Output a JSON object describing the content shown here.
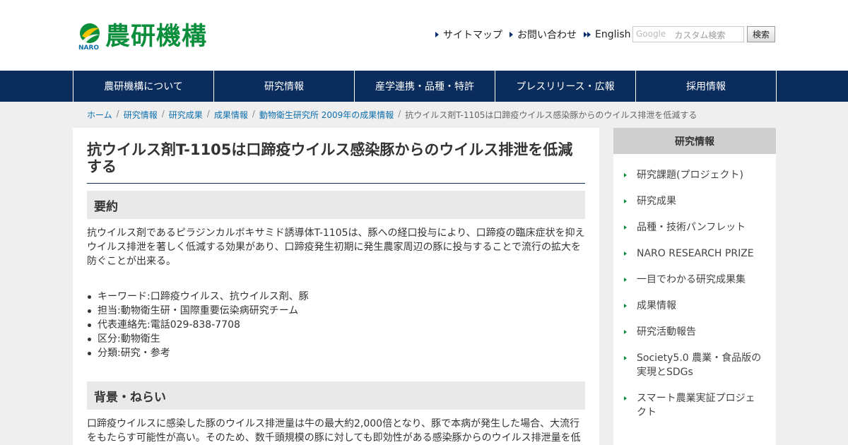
{
  "logo": {
    "text": "農研機構",
    "sub": "NARO"
  },
  "toplinks": {
    "sitemap": "サイトマップ",
    "contact": "お問い合わせ",
    "english": "English"
  },
  "search": {
    "brand": "Google",
    "placeholder": "カスタム検索",
    "button": "検索"
  },
  "nav": [
    "農研機構について",
    "研究情報",
    "産学連携・品種・特許",
    "プレスリリース・広報",
    "採用情報"
  ],
  "breadcrumb": [
    "ホーム",
    "研究情報",
    "研究成果",
    "成果情報",
    "動物衛生研究所 2009年の成果情報",
    "抗ウイルス剤T-1105は口蹄疫ウイルス感染豚からのウイルス排泄を低減する"
  ],
  "article": {
    "title": "抗ウイルス剤T-1105は口蹄疫ウイルス感染豚からのウイルス排泄を低減する",
    "summary_heading": "要約",
    "summary": "抗ウイルス剤であるピラジンカルボキサミド誘導体T-1105は、豚への経口投与により、口蹄疫の臨床症状を抑えウイルス排泄を著しく低減する効果があり、口蹄疫発生初期に発生農家周辺の豚に投与することで流行の拡大を防ぐことが出来る。",
    "meta": [
      "キーワード:口蹄疫ウイルス、抗ウイルス剤、豚",
      "担当:動物衛生研・国際重要伝染病研究チーム",
      "代表連絡先:電話029-838-7708",
      "区分:動物衛生",
      "分類:研究・参考"
    ],
    "background_heading": "背景・ねらい",
    "background": "口蹄疫ウイルスに感染した豚のウイルス排泄量は牛の最大約2,000倍となり、豚で本病が発生した場合、大流行をもたらす可能性が高い。そのため、数千頭規模の豚に対しても即効性がある感染豚からのウイルス排泄量を低"
  },
  "sidebar": {
    "heading": "研究情報",
    "items": [
      "研究課題(プロジェクト)",
      "研究成果",
      "品種・技術パンフレット",
      "NARO RESEARCH PRIZE",
      "一目でわかる研究成果集",
      "成果情報",
      "研究活動報告",
      "Society5.0 農業・食品版の実現とSDGs",
      "スマート農業実証プロジェクト"
    ]
  },
  "colors": {
    "brand_green": "#0c8f3c",
    "nav_navy": "#0a2d5e",
    "link_blue": "#0c6fae"
  }
}
